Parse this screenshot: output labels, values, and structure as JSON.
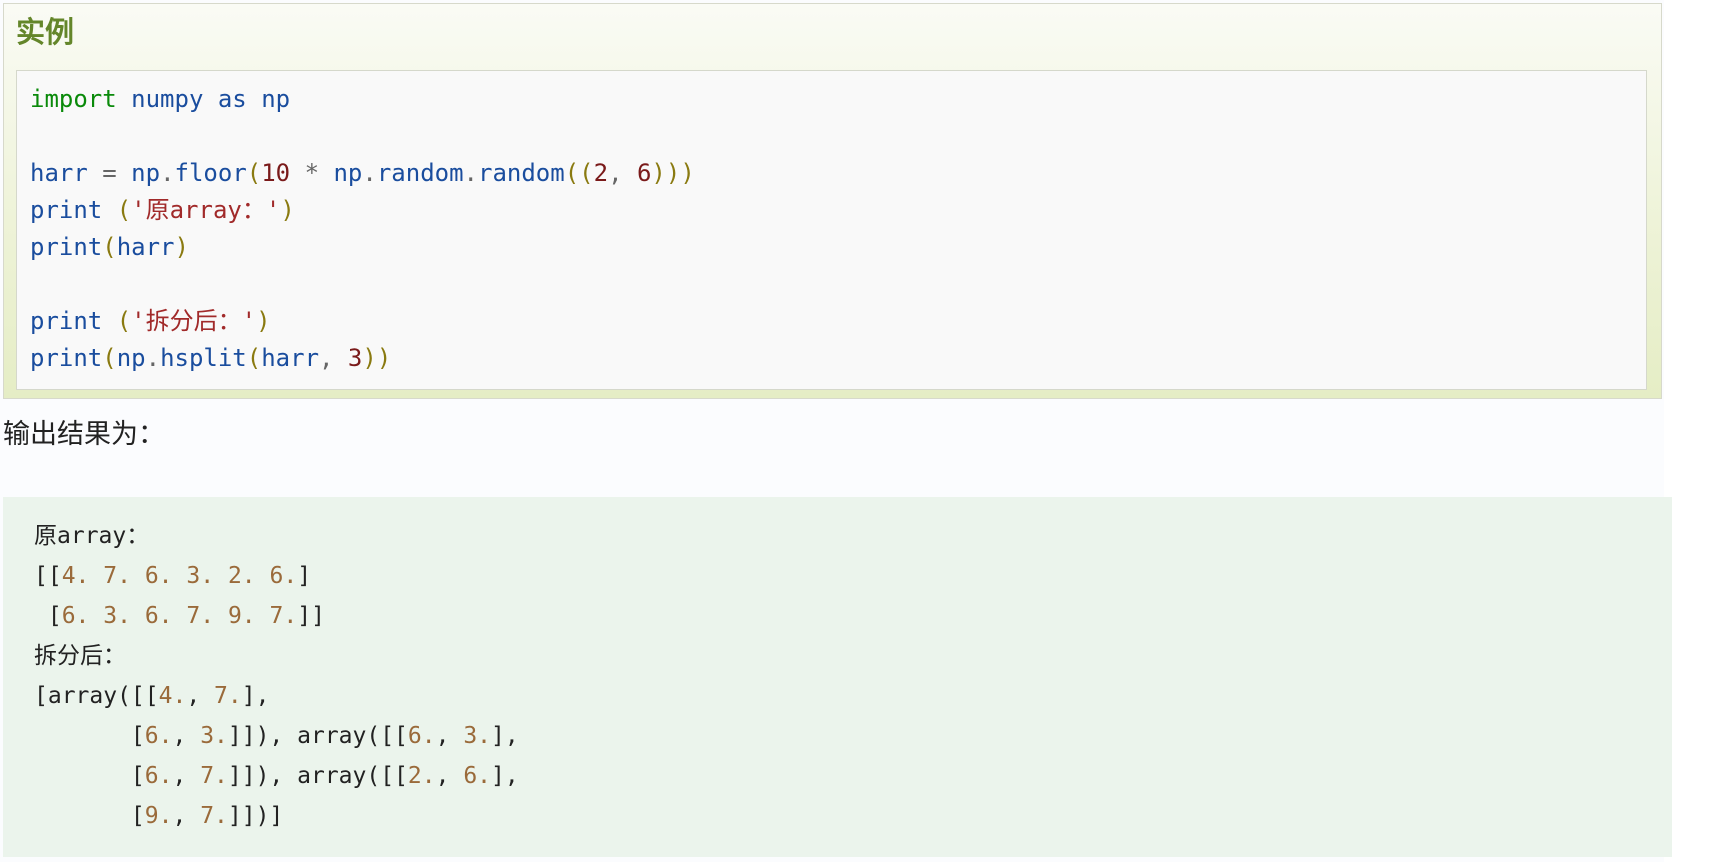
{
  "example": {
    "title": "实例",
    "code_lines": [
      [
        [
          "kw",
          "import"
        ],
        [
          "pl",
          " "
        ],
        [
          "id",
          "numpy"
        ],
        [
          "pl",
          " "
        ],
        [
          "id",
          "as"
        ],
        [
          "pl",
          " "
        ],
        [
          "id",
          "np"
        ]
      ],
      [],
      [
        [
          "id",
          "harr"
        ],
        [
          "pl",
          " "
        ],
        [
          "op",
          "="
        ],
        [
          "pl",
          " "
        ],
        [
          "id",
          "np"
        ],
        [
          "op",
          "."
        ],
        [
          "id",
          "floor"
        ],
        [
          "par",
          "("
        ],
        [
          "num",
          "10"
        ],
        [
          "pl",
          " "
        ],
        [
          "op",
          "*"
        ],
        [
          "pl",
          " "
        ],
        [
          "id",
          "np"
        ],
        [
          "op",
          "."
        ],
        [
          "id",
          "random"
        ],
        [
          "op",
          "."
        ],
        [
          "id",
          "random"
        ],
        [
          "par",
          "(("
        ],
        [
          "num",
          "2"
        ],
        [
          "op",
          ","
        ],
        [
          "pl",
          " "
        ],
        [
          "num",
          "6"
        ],
        [
          "par",
          ")))"
        ]
      ],
      [
        [
          "id",
          "print"
        ],
        [
          "pl",
          " "
        ],
        [
          "par",
          "("
        ],
        [
          "str",
          "'原array："
        ],
        [
          "str",
          "'"
        ],
        [
          "par",
          ")"
        ]
      ],
      [
        [
          "id",
          "print"
        ],
        [
          "par",
          "("
        ],
        [
          "id",
          "harr"
        ],
        [
          "par",
          ")"
        ]
      ],
      [],
      [
        [
          "id",
          "print"
        ],
        [
          "pl",
          " "
        ],
        [
          "par",
          "("
        ],
        [
          "str",
          "'拆分后："
        ],
        [
          "str",
          "'"
        ],
        [
          "par",
          ")"
        ]
      ],
      [
        [
          "id",
          "print"
        ],
        [
          "par",
          "("
        ],
        [
          "id",
          "np"
        ],
        [
          "op",
          "."
        ],
        [
          "id",
          "hsplit"
        ],
        [
          "par",
          "("
        ],
        [
          "id",
          "harr"
        ],
        [
          "op",
          ","
        ],
        [
          "pl",
          " "
        ],
        [
          "num",
          "3"
        ],
        [
          "par",
          "))"
        ]
      ]
    ]
  },
  "result_label": "输出结果为：",
  "output_lines": [
    [
      [
        "zh",
        "原"
      ],
      [
        "pl",
        "array："
      ]
    ],
    [
      [
        "pl",
        "[["
      ],
      [
        "num",
        "4."
      ],
      [
        "pl",
        " "
      ],
      [
        "num",
        "7."
      ],
      [
        "pl",
        " "
      ],
      [
        "num",
        "6."
      ],
      [
        "pl",
        " "
      ],
      [
        "num",
        "3."
      ],
      [
        "pl",
        " "
      ],
      [
        "num",
        "2."
      ],
      [
        "pl",
        " "
      ],
      [
        "num",
        "6."
      ],
      [
        "pl",
        "]"
      ]
    ],
    [
      [
        "pl",
        " ["
      ],
      [
        "num",
        "6."
      ],
      [
        "pl",
        " "
      ],
      [
        "num",
        "3."
      ],
      [
        "pl",
        " "
      ],
      [
        "num",
        "6."
      ],
      [
        "pl",
        " "
      ],
      [
        "num",
        "7."
      ],
      [
        "pl",
        " "
      ],
      [
        "num",
        "9."
      ],
      [
        "pl",
        " "
      ],
      [
        "num",
        "7."
      ],
      [
        "pl",
        "]]"
      ]
    ],
    [
      [
        "zh",
        "拆分后："
      ]
    ],
    [
      [
        "pl",
        "[array([["
      ],
      [
        "num",
        "4."
      ],
      [
        "pl",
        ", "
      ],
      [
        "num",
        "7."
      ],
      [
        "pl",
        "],"
      ]
    ],
    [
      [
        "pl",
        "       ["
      ],
      [
        "num",
        "6."
      ],
      [
        "pl",
        ", "
      ],
      [
        "num",
        "3."
      ],
      [
        "pl",
        "]]), array([["
      ],
      [
        "num",
        "6."
      ],
      [
        "pl",
        ", "
      ],
      [
        "num",
        "3."
      ],
      [
        "pl",
        "],"
      ]
    ],
    [
      [
        "pl",
        "       ["
      ],
      [
        "num",
        "6."
      ],
      [
        "pl",
        ", "
      ],
      [
        "num",
        "7."
      ],
      [
        "pl",
        "]]), array([["
      ],
      [
        "num",
        "2."
      ],
      [
        "pl",
        ", "
      ],
      [
        "num",
        "6."
      ],
      [
        "pl",
        "],"
      ]
    ],
    [
      [
        "pl",
        "       ["
      ],
      [
        "num",
        "9."
      ],
      [
        "pl",
        ", "
      ],
      [
        "num",
        "7."
      ],
      [
        "pl",
        "]])]"
      ]
    ]
  ],
  "colors": {
    "title_green": "#64862a",
    "keyword_green": "#0a8a0a",
    "identifier_blue": "#1a4d9e",
    "number_maroon": "#7a1a1a",
    "string_red": "#a12a2a",
    "paren_olive": "#8a7a10",
    "output_number_brown": "#9a6a3a",
    "output_background": "#ebf4ec"
  }
}
